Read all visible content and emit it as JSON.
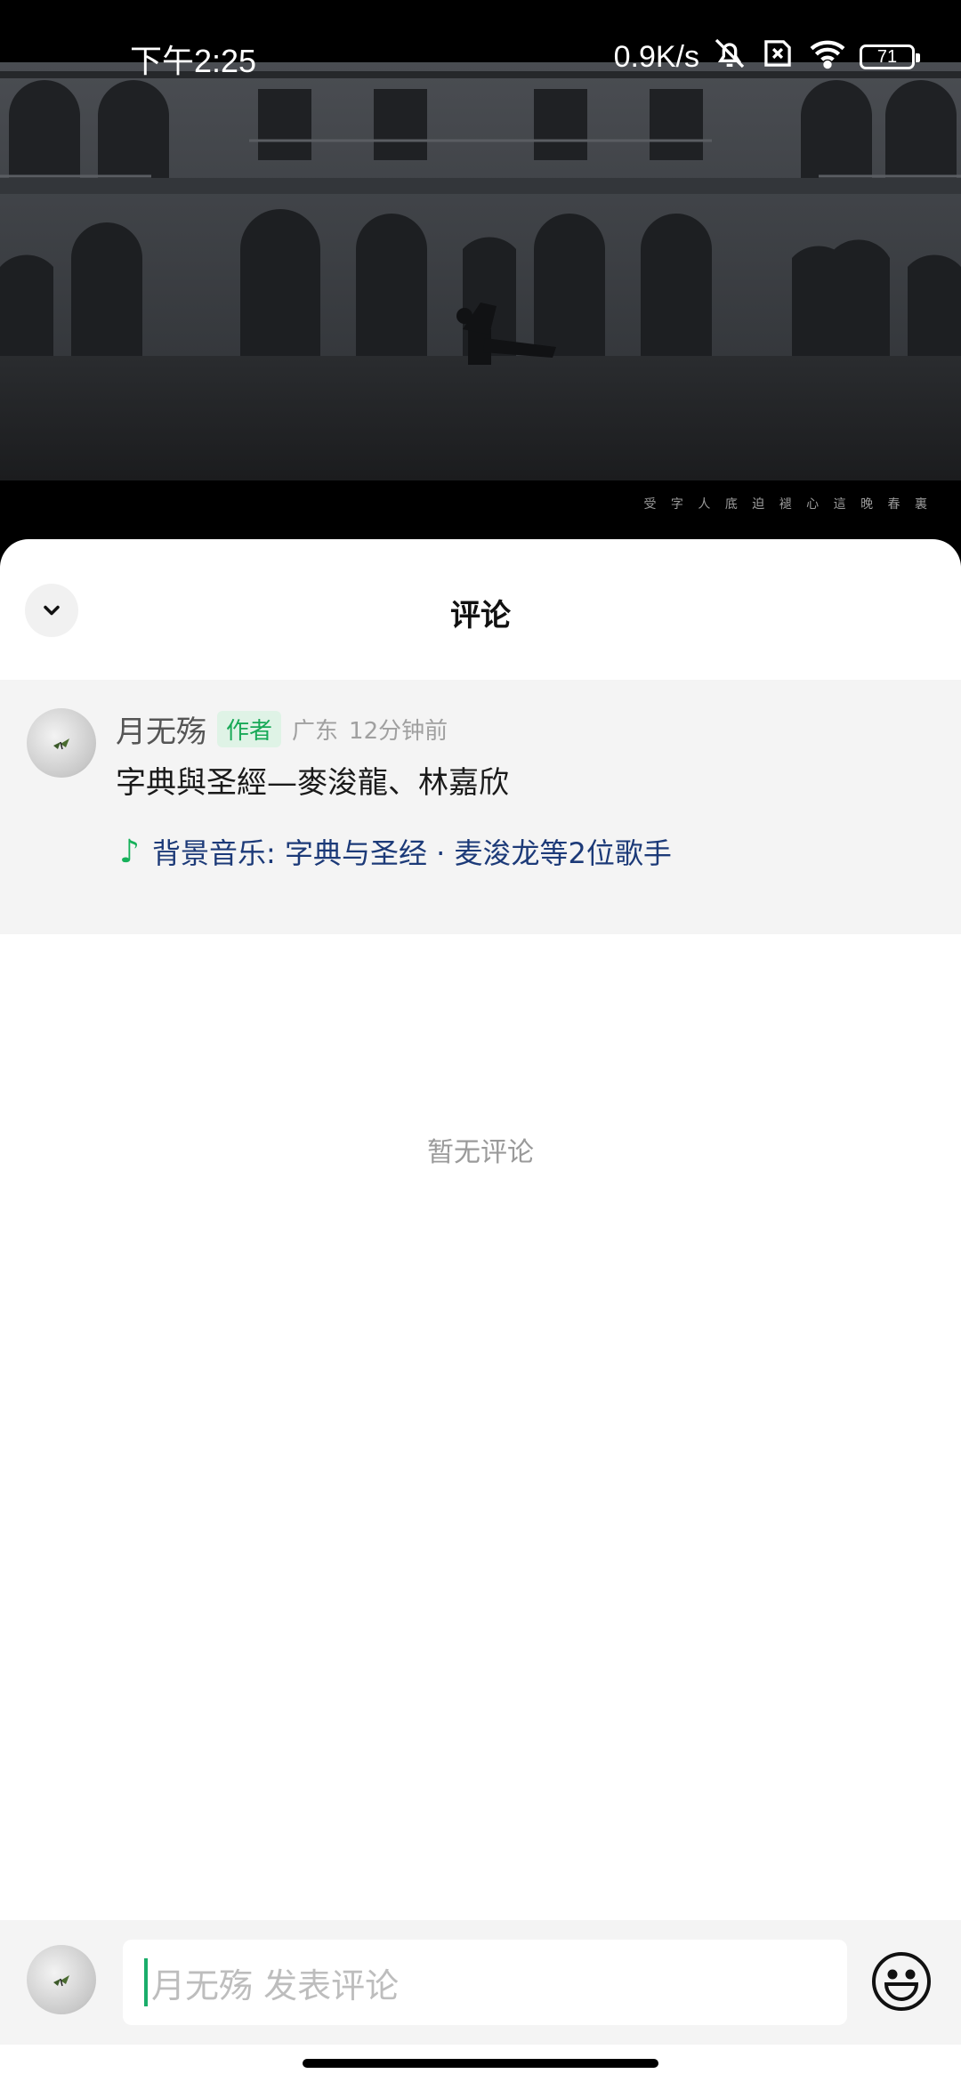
{
  "status_bar": {
    "time": "下午2:25",
    "network_speed": "0.9K/s",
    "battery": "71",
    "icons": [
      "bell-muted-icon",
      "sim-off-icon",
      "wifi-icon",
      "battery-icon"
    ]
  },
  "video": {
    "caption": "受 字 人 底 迫 褪 心    這 晚 春 裏"
  },
  "sheet": {
    "title": "评论",
    "collapse_icon": "chevron-down-icon"
  },
  "author_post": {
    "name": "月无殇",
    "tag": "作者",
    "location": "广东",
    "time_ago": "12分钟前",
    "description": "字典與圣經—麥浚龍、林嘉欣",
    "music_icon": "music-note-icon",
    "music_label": "背景音乐: 字典与圣经 · 麦浚龙等2位歌手"
  },
  "empty_state": "暂无评论",
  "comment_bar": {
    "placeholder": "月无殇 发表评论",
    "emoji_icon": "emoji-icon"
  }
}
